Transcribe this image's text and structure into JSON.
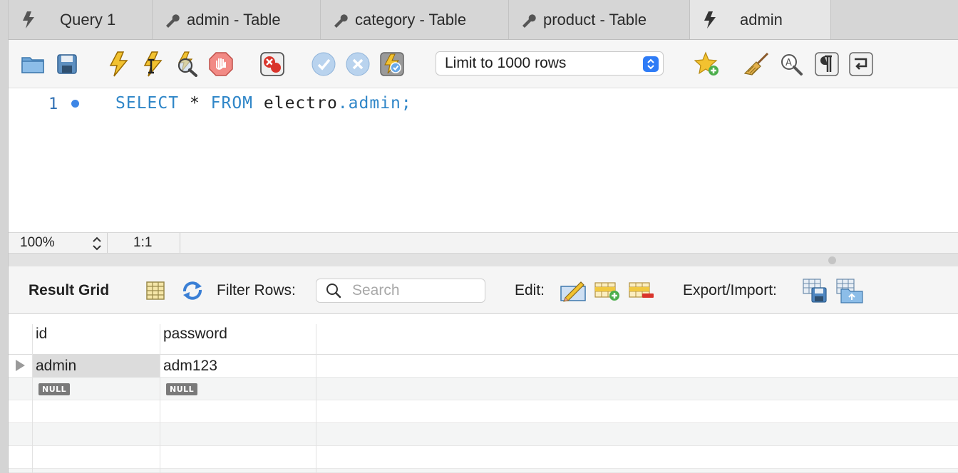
{
  "tabs": [
    {
      "label": "Query 1",
      "icon": "lightning-icon",
      "active": false
    },
    {
      "label": "admin - Table",
      "icon": "wrench-icon",
      "active": false
    },
    {
      "label": "category - Table",
      "icon": "wrench-icon",
      "active": false
    },
    {
      "label": "product - Table",
      "icon": "wrench-icon",
      "active": false
    },
    {
      "label": "admin",
      "icon": "lightning-icon",
      "active": true
    }
  ],
  "toolbar": {
    "limit_select": "Limit to 1000 rows"
  },
  "editor": {
    "line_number": "1",
    "query": {
      "kw_select": "SELECT",
      "star": " * ",
      "kw_from": "FROM",
      "schema": " electro",
      "dot": ".",
      "table": "admin",
      "semicolon": ";"
    }
  },
  "status": {
    "zoom": "100%",
    "cursor_position": "1:1"
  },
  "result_toolbar": {
    "result_grid_label": "Result Grid",
    "filter_rows_label": "Filter Rows:",
    "search_placeholder": "Search",
    "edit_label": "Edit:",
    "export_import_label": "Export/Import:"
  },
  "grid": {
    "columns": [
      "id",
      "password"
    ],
    "rows": [
      [
        "admin",
        "adm123"
      ]
    ],
    "null_label": "NULL"
  },
  "colors": {
    "accent": "#2f7cf6",
    "keyword": "#2f86c8",
    "tab_bar": "#d6d6d6"
  }
}
